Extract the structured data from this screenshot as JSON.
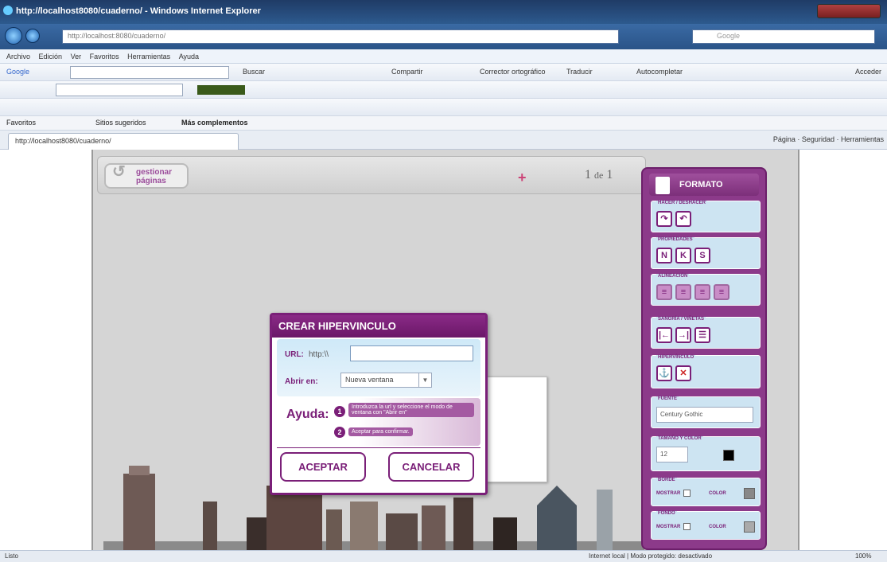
{
  "window": {
    "title": "http://localhost8080/cuaderno/ - Windows Internet Explorer"
  },
  "address": {
    "url": "http://localhost:8080/cuaderno/",
    "search_placeholder": "Google"
  },
  "menu": [
    "Archivo",
    "Edición",
    "Ver",
    "Favoritos",
    "Herramientas",
    "Ayuda"
  ],
  "toolbar_google": {
    "label": "Google",
    "items": [
      "Buscar",
      "Compartir",
      "Corrector ortográfico",
      "Traducir",
      "Autocompletar"
    ],
    "signin": "Acceder"
  },
  "favbar": {
    "favorites": "Favoritos",
    "suggested": "Sitios sugeridos",
    "addons": "Más complementos"
  },
  "tab": {
    "title": "http://localhost8080/cuaderno/"
  },
  "tabcmds": [
    "Página",
    "Seguridad",
    "Herramientas"
  ],
  "pages": {
    "button": "gestionar páginas",
    "current": "1",
    "of": "de",
    "total": "1"
  },
  "dialog": {
    "title": "CREAR HIPERVINCULO",
    "url_label": "URL:",
    "url_prefix": "http:\\\\",
    "url_value": "",
    "open_label": "Abrir en:",
    "open_value": "Nueva ventana",
    "help_label": "Ayuda:",
    "help_step1": "Introduzca la url y seleccione el modo de ventana con \"Abrir en\"",
    "help_step2": "Aceptar para confirmar.",
    "accept": "ACEPTAR",
    "cancel": "CANCELAR"
  },
  "format": {
    "title": "FORMATO",
    "undo_redo": "HACER / DESHACER",
    "properties": "PROPIEDADES",
    "prop_buttons": [
      "N",
      "K",
      "S"
    ],
    "alignment": "ALINEACIÓN",
    "indent_bullets": "SANGRÍA / VIÑETAS",
    "hyperlink": "HIPERVÍNCULO",
    "font": "FUENTE",
    "font_value": "Century Gothic",
    "size_color": "TAMAÑO Y COLOR",
    "size_value": "12",
    "border": "BORDE",
    "background": "FONDO",
    "show": "MOSTRAR",
    "color": "COLOR"
  },
  "status": {
    "left": "Listo",
    "zone": "Internet local | Modo protegido: desactivado",
    "zoom": "100%"
  }
}
